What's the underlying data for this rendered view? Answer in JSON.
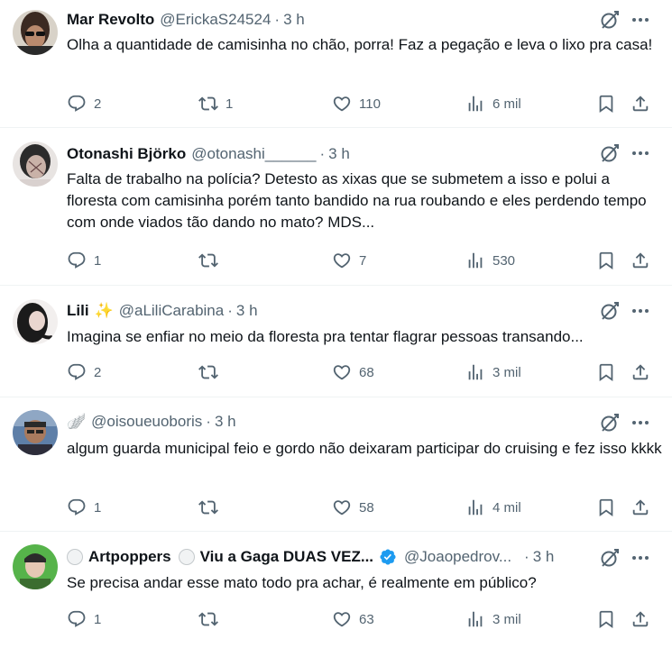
{
  "tweets": [
    {
      "name": "Mar Revolto",
      "handle": "@ErickaS24524",
      "time": "3 h",
      "text": "Olha a quantidade de camisinha no chão, porra! Faz a pegação e leva o lixo pra casa!",
      "replies": "2",
      "retweets": "1",
      "likes": "110",
      "views": "6 mil"
    },
    {
      "name": "Otonashi Björko",
      "handle": "@otonashi______",
      "time": "3 h",
      "text": "Falta de trabalho na polícia? Detesto as xixas que se submetem a isso e polui a floresta com camisinha porém tanto bandido na rua roubando e eles perdendo tempo com onde viados tão dando no mato? MDS...",
      "replies": "1",
      "retweets": "",
      "likes": "7",
      "views": "530"
    },
    {
      "name": "Lili",
      "name_emoji": "✨",
      "handle": "@aLiliCarabina",
      "time": "3 h",
      "text": "Imagina se enfiar no meio da floresta pra tentar flagrar pessoas transando...",
      "replies": "2",
      "retweets": "",
      "likes": "68",
      "views": "3 mil"
    },
    {
      "name": "",
      "name_emoji": "🪽",
      "handle": "@oisoueuoboris",
      "time": "3 h",
      "text": "algum guarda municipal feio e gordo não deixaram participar do cruising e fez isso kkkk",
      "replies": "1",
      "retweets": "",
      "likes": "58",
      "views": "4 mil"
    },
    {
      "name_part1": "Artpoppers",
      "name_part2": "Viu a Gaga DUAS VEZ...",
      "handle": "@Joaopedrov...",
      "time": "3 h",
      "text": "Se precisa andar esse mato todo pra achar, é realmente em público?",
      "replies": "1",
      "retweets": "",
      "likes": "63",
      "views": "3 mil"
    }
  ],
  "icons": {
    "reply": "reply-icon",
    "retweet": "retweet-icon",
    "like": "heart-icon",
    "views": "views-icon",
    "bookmark": "bookmark-icon",
    "share": "share-icon",
    "grok": "grok-icon",
    "more": "more-icon"
  },
  "colors": {
    "text": "#0f1419",
    "secondary": "#536471",
    "divider": "#eff3f4",
    "verified": "#1d9bf0"
  },
  "dot": "·"
}
